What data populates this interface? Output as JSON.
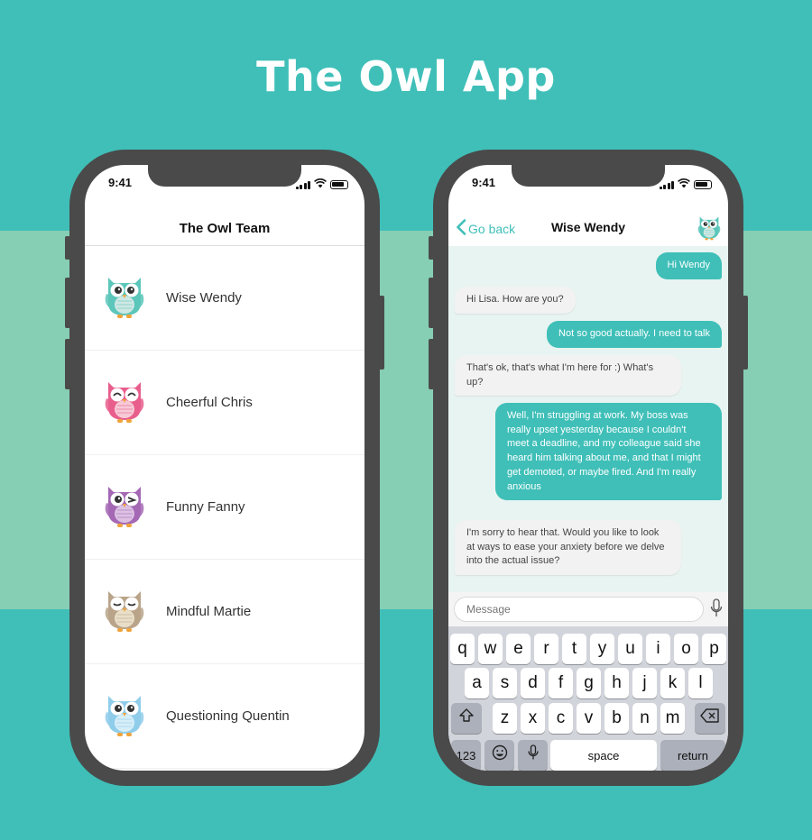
{
  "page_title": "The Owl App",
  "left_phone": {
    "time": "9:41",
    "nav_title": "The Owl Team",
    "owls": [
      {
        "name": "Wise Wendy",
        "color": "#5cc6ba",
        "belly": "#cfe8e4",
        "eyes": "open"
      },
      {
        "name": "Cheerful Chris",
        "color": "#e85e8c",
        "belly": "#f7c9d7",
        "eyes": "happy"
      },
      {
        "name": "Funny Fanny",
        "color": "#a468b4",
        "belly": "#dcc1e3",
        "eyes": "wink"
      },
      {
        "name": "Mindful Martie",
        "color": "#b9a48a",
        "belly": "#e9dfc9",
        "eyes": "closed"
      },
      {
        "name": "Questioning Quentin",
        "color": "#8fcdeb",
        "belly": "#d6eef8",
        "eyes": "open"
      }
    ]
  },
  "right_phone": {
    "time": "9:41",
    "back_label": "Go back",
    "chat_title": "Wise Wendy",
    "messages": [
      {
        "from": "me",
        "text": "Hi Wendy"
      },
      {
        "from": "owl",
        "text": "Hi Lisa. How are you?"
      },
      {
        "from": "me",
        "text": "Not so good actually. I need to talk"
      },
      {
        "from": "owl",
        "text": "That's ok, that's what I'm here for :) What's up?"
      },
      {
        "from": "me",
        "text": "Well, I'm struggling at work. My boss was really upset yesterday because I couldn't meet a deadline, and my colleague said she heard him talking about me, and that I might get demoted, or maybe fired. And I'm really anxious"
      },
      {
        "from": "owl",
        "text": "I'm sorry to hear that. Would you like to look at ways to ease your anxiety before we delve into the actual issue?"
      }
    ],
    "input_placeholder": "Message",
    "keyboard": {
      "row1": [
        "q",
        "w",
        "e",
        "r",
        "t",
        "y",
        "u",
        "i",
        "o",
        "p"
      ],
      "row2": [
        "a",
        "s",
        "d",
        "f",
        "g",
        "h",
        "j",
        "k",
        "l"
      ],
      "row3": [
        "z",
        "x",
        "c",
        "v",
        "b",
        "n",
        "m"
      ],
      "numbers_label": "123",
      "space_label": "space",
      "return_label": "return"
    }
  },
  "colors": {
    "background": "#3fbfb8",
    "band": "#86cfb5",
    "accent": "#3fbfb8",
    "phone_frame": "#4a4a4a"
  }
}
